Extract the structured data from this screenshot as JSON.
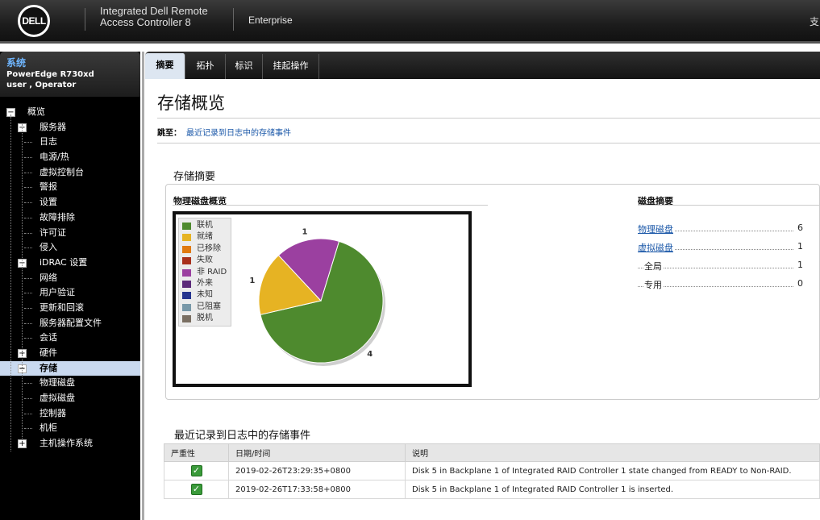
{
  "header": {
    "logo": "DELL",
    "title_line1": "Integrated Dell Remote",
    "title_line2": "Access Controller 8",
    "edition": "Enterprise",
    "right_text": "支"
  },
  "system": {
    "title": "系统",
    "model": "PowerEdge R730xd",
    "user": "user , Operator"
  },
  "tree": [
    {
      "label": "概览",
      "toggle": "−"
    },
    {
      "label": "服务器",
      "toggle": "−"
    },
    {
      "label": "日志"
    },
    {
      "label": "电源/热"
    },
    {
      "label": "虚拟控制台"
    },
    {
      "label": "警报"
    },
    {
      "label": "设置"
    },
    {
      "label": "故障排除"
    },
    {
      "label": "许可证"
    },
    {
      "label": "侵入"
    },
    {
      "label": "iDRAC 设置",
      "toggle": "−"
    },
    {
      "label": "网络"
    },
    {
      "label": "用户验证"
    },
    {
      "label": "更新和回滚"
    },
    {
      "label": "服务器配置文件"
    },
    {
      "label": "会话"
    },
    {
      "label": "硬件",
      "toggle": "+"
    },
    {
      "label": "存储",
      "toggle": "−",
      "selected": true
    },
    {
      "label": "物理磁盘"
    },
    {
      "label": "虚拟磁盘"
    },
    {
      "label": "控制器"
    },
    {
      "label": "机柜"
    },
    {
      "label": "主机操作系统",
      "toggle": "+"
    }
  ],
  "tabs": [
    "摘要",
    "拓扑",
    "标识",
    "挂起操作"
  ],
  "active_tab": "摘要",
  "page": {
    "title": "存储概览",
    "jump_label": "跳至：",
    "jump_link": "最近记录到日志中的存储事件"
  },
  "summary": {
    "title": "存储摘要",
    "physical_overview": "物理磁盘概览",
    "disk_summary": "磁盘摘要",
    "disk_rows": [
      {
        "label": "物理磁盘",
        "value": "6",
        "link": true
      },
      {
        "label": "虚拟磁盘",
        "value": "1",
        "link": true
      },
      {
        "label": "全局",
        "value": "1",
        "link": false
      },
      {
        "label": "专用",
        "value": "0",
        "link": false
      }
    ]
  },
  "chart_data": {
    "type": "pie",
    "legend_items": [
      {
        "name": "联机",
        "color": "#4e8a2e"
      },
      {
        "name": "就绪",
        "color": "#e6b323"
      },
      {
        "name": "已移除",
        "color": "#e07a10"
      },
      {
        "name": "失败",
        "color": "#a8301c"
      },
      {
        "name": "非 RAID",
        "color": "#9b40a0"
      },
      {
        "name": "外来",
        "color": "#5c2a7a"
      },
      {
        "name": "未知",
        "color": "#26358f"
      },
      {
        "name": "已阻塞",
        "color": "#7898a8"
      },
      {
        "name": "脱机",
        "color": "#7a6f62"
      }
    ],
    "slices": [
      {
        "name": "联机",
        "value": 4,
        "color": "#4e8a2e"
      },
      {
        "name": "就绪",
        "value": 1,
        "color": "#e6b323"
      },
      {
        "name": "非 RAID",
        "value": 1,
        "color": "#9b40a0"
      }
    ],
    "legend_position": "top-left"
  },
  "events": {
    "title": "最近记录到日志中的存储事件",
    "headers": [
      "严重性",
      "日期/时间",
      "说明"
    ],
    "rows": [
      {
        "severity": "ok-icon",
        "datetime": "2019-02-26T23:29:35+0800",
        "desc": "Disk 5 in Backplane 1 of Integrated RAID Controller 1 state changed from READY to Non-RAID."
      },
      {
        "severity": "ok-icon",
        "datetime": "2019-02-26T17:33:58+0800",
        "desc": "Disk 5 in Backplane 1 of Integrated RAID Controller 1 is inserted."
      }
    ]
  }
}
